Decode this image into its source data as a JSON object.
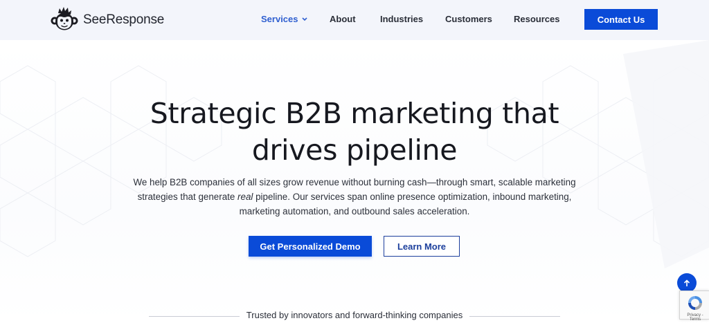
{
  "header": {
    "brand": "SeeResponse",
    "nav": [
      {
        "label": "Services",
        "active": true,
        "has_dropdown": true
      },
      {
        "label": "About",
        "active": false
      },
      {
        "label": "Industries",
        "active": false
      },
      {
        "label": "Customers",
        "active": false
      },
      {
        "label": "Resources",
        "active": false
      }
    ],
    "contact_label": "Contact Us"
  },
  "hero": {
    "headline_line1": "Strategic B2B marketing that",
    "headline_line2": "drives pipeline",
    "sub_part1": "We help B2B companies of all sizes grow revenue without burning cash—through smart, scalable marketing strategies that generate ",
    "sub_em": "real",
    "sub_part2": " pipeline. Our services span online presence optimization, inbound marketing, marketing automation, and outbound sales acceleration.",
    "primary_cta": "Get Personalized Demo",
    "secondary_cta": "Learn More"
  },
  "trusted": {
    "text": "Trusted by innovators and forward-thinking companies"
  },
  "widgets": {
    "scroll_top_icon": "arrow-up-icon",
    "recaptcha_text": "Privacy - Terms"
  },
  "colors": {
    "accent": "#0a4bd8",
    "nav_active": "#2f5fd0",
    "header_bg": "#f3f5fb",
    "outline": "#1c3f9c"
  }
}
